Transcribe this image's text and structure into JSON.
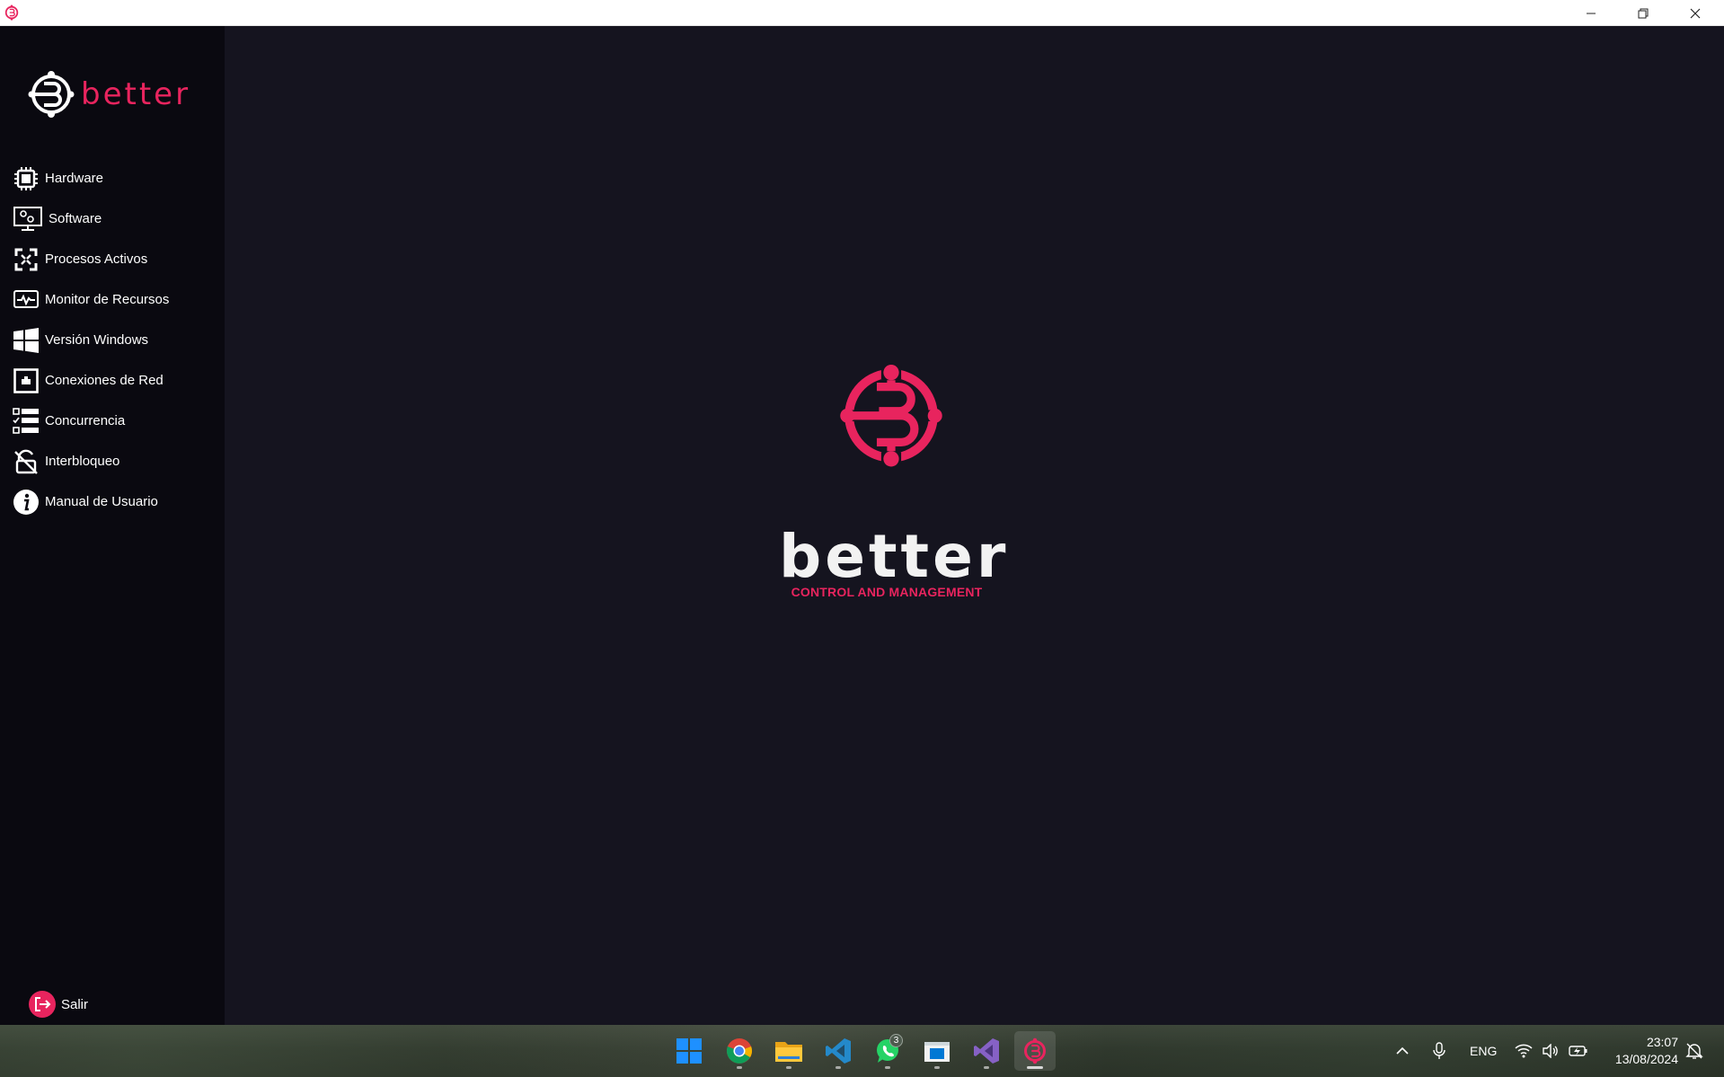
{
  "window": {
    "title_icon": "better-logo-icon",
    "controls": [
      "minimize-icon",
      "restore-icon",
      "close-icon"
    ]
  },
  "sidebar": {
    "brand": "better",
    "items": [
      {
        "label": "Hardware",
        "icon": "cpu-icon"
      },
      {
        "label": "Software",
        "icon": "monitor-gear-icon"
      },
      {
        "label": "Procesos Activos",
        "icon": "process-arrows-icon"
      },
      {
        "label": "Monitor de Recursos",
        "icon": "pulse-monitor-icon"
      },
      {
        "label": "Versión Windows",
        "icon": "windows-icon"
      },
      {
        "label": "Conexiones de Red",
        "icon": "network-icon"
      },
      {
        "label": "Concurrencia",
        "icon": "checklist-icon"
      },
      {
        "label": "Interbloqueo",
        "icon": "unlocked-icon"
      },
      {
        "label": "Manual de Usuario",
        "icon": "info-icon"
      }
    ],
    "exit_label": "Salir"
  },
  "main": {
    "logo_word": "better",
    "tagline": "CONTROL AND MANAGEMENT"
  },
  "taskbar": {
    "apps": [
      "windows-start-icon",
      "chrome-icon",
      "file-explorer-icon",
      "vscode-icon",
      "whatsapp-icon",
      "store-icon",
      "visual-studio-icon",
      "better-app-icon"
    ],
    "whatsapp_badge": "3",
    "language": "ENG",
    "time": "23:07",
    "date": "13/08/2024"
  },
  "colors": {
    "accent": "#e8245e",
    "sidebar_bg": "#0a0910",
    "main_bg": "#15141f"
  }
}
